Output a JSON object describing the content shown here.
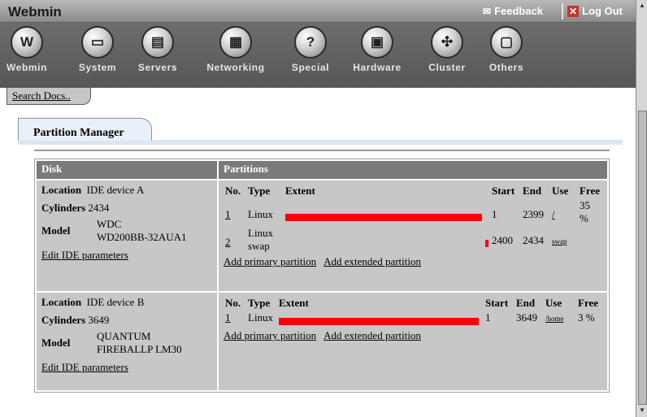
{
  "header": {
    "app_title": "Webmin",
    "feedback": "Feedback",
    "logout": "Log Out"
  },
  "toolbar": {
    "items": [
      {
        "label": "Webmin",
        "glyph": "W"
      },
      {
        "label": "System",
        "glyph": "▭"
      },
      {
        "label": "Servers",
        "glyph": "▤"
      },
      {
        "label": "Networking",
        "glyph": "▦"
      },
      {
        "label": "Special",
        "glyph": "?"
      },
      {
        "label": "Hardware",
        "glyph": "▣"
      },
      {
        "label": "Cluster",
        "glyph": "✣"
      },
      {
        "label": "Others",
        "glyph": "▢"
      }
    ]
  },
  "search_docs": "Search Docs..",
  "module_tab": "Partition Manager",
  "table": {
    "disk_header": "Disk",
    "partitions_header": "Partitions",
    "col_no": "No.",
    "col_type": "Type",
    "col_extent": "Extent",
    "col_start": "Start",
    "col_end": "End",
    "col_use": "Use",
    "col_free": "Free",
    "label_location": "Location",
    "label_cylinders": "Cylinders",
    "label_model": "Model",
    "edit_ide": "Edit IDE parameters",
    "add_primary": "Add primary partition",
    "add_extended": "Add extended partition"
  },
  "disks": [
    {
      "location": "IDE device A",
      "cylinders": "2434",
      "model_line1": "WDC",
      "model_line2": "WD200BB-32AUA1",
      "partitions": [
        {
          "no": "1",
          "type_line1": "Linux",
          "type_line2": "",
          "start": "1",
          "end": "2399",
          "use": "/",
          "free_line1": "35",
          "free_line2": "%",
          "extent_fraction": 0.985
        },
        {
          "no": "2",
          "type_line1": "Linux",
          "type_line2": "swap",
          "start": "2400",
          "end": "2434",
          "use": "swap",
          "free_line1": "",
          "free_line2": "",
          "extent_fraction": 0.015
        }
      ]
    },
    {
      "location": "IDE device B",
      "cylinders": "3649",
      "model_line1": "QUANTUM",
      "model_line2": "FIREBALLP LM30",
      "partitions": [
        {
          "no": "1",
          "type_line1": "Linux",
          "type_line2": "",
          "start": "1",
          "end": "3649",
          "use": "/home",
          "free_line1": "3 %",
          "free_line2": "",
          "extent_fraction": 1.0
        }
      ]
    }
  ]
}
